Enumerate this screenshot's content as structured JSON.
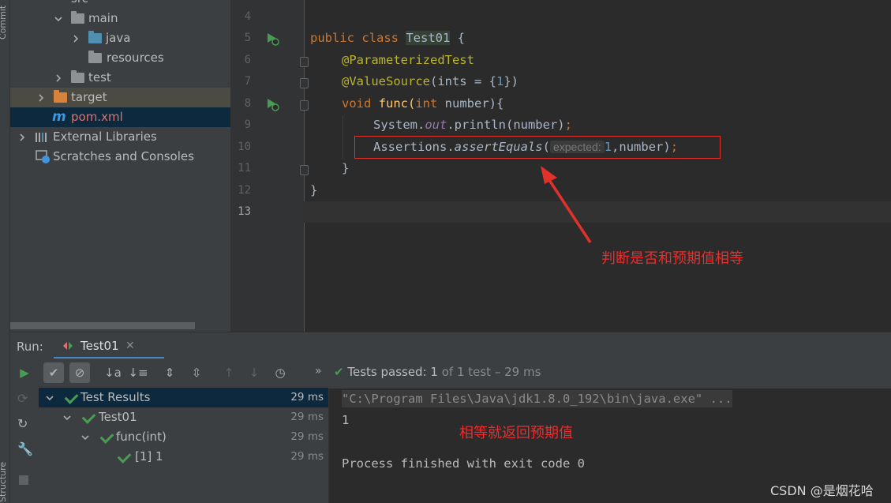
{
  "side_strip": {
    "commit": "Commit",
    "structure": "Structure"
  },
  "project_tree": {
    "items": [
      {
        "label": "src"
      },
      {
        "label": "main"
      },
      {
        "label": "java"
      },
      {
        "label": "resources"
      },
      {
        "label": "test"
      },
      {
        "label": "target"
      },
      {
        "label": "pom.xml",
        "icon_letter": "m"
      },
      {
        "label": "External Libraries"
      },
      {
        "label": "Scratches and Consoles"
      }
    ]
  },
  "editor": {
    "line_numbers": [
      "4",
      "5",
      "6",
      "7",
      "8",
      "9",
      "10",
      "11",
      "12",
      "13"
    ],
    "code": {
      "l5_kw": "public class ",
      "l5_class": "Test01",
      "l5_rest": " {",
      "l6_ann": "@ParameterizedTest",
      "l7_ann": "@ValueSource",
      "l7_rest1": "(ints = {",
      "l7_num": "1",
      "l7_rest2": "})",
      "l8_kw1": "void ",
      "l8_name": "func(",
      "l8_kw2": "int",
      "l8_rest": " number){",
      "l9_a": "System.",
      "l9_out": "out",
      "l9_b": ".println(number)",
      "l9_semi": ";",
      "l10_a": "Assertions.",
      "l10_method": "assertEquals",
      "l10_paren": "(",
      "l10_hint": "expected:",
      "l10_num": "1",
      "l10_b": ",number)",
      "l10_semi": ";",
      "l11": "}",
      "l12": "}"
    },
    "annotation_note": "判断是否和预期值相等"
  },
  "run_panel": {
    "label": "Run:",
    "tab_label": "Test01",
    "status_prefix": "Tests passed: ",
    "status_count": "1",
    "status_rest": " of 1 test – 29 ms",
    "results": [
      {
        "label": "Test Results",
        "duration": "29 ms"
      },
      {
        "label": "Test01",
        "duration": "29 ms"
      },
      {
        "label": "func(int)",
        "duration": "29 ms"
      },
      {
        "label": "[1] 1",
        "duration": "29 ms"
      }
    ],
    "console": {
      "command": "\"C:\\Program Files\\Java\\jdk1.8.0_192\\bin\\java.exe\" ...",
      "output": "1",
      "exit": "Process finished with exit code 0"
    },
    "console_note": "相等就返回预期值"
  },
  "watermark": "CSDN @是烟花哈",
  "colors": {
    "accent_green": "#499c54",
    "annotation_red": "#ee2c2c",
    "selection_blue": "#0d293e"
  }
}
